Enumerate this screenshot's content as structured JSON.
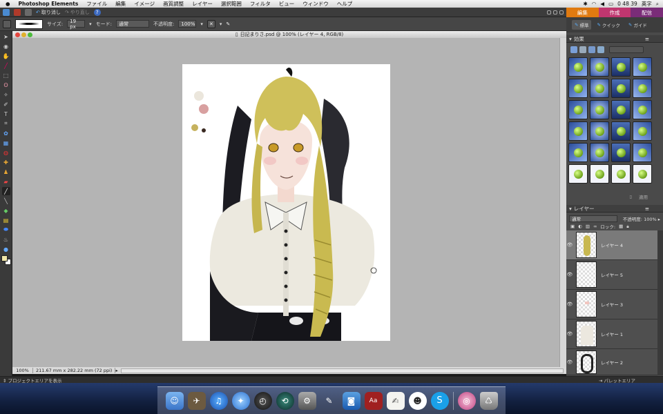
{
  "menubar": {
    "apple": "",
    "items": [
      "Photoshop Elements",
      "ファイル",
      "編集",
      "イメージ",
      "画質調整",
      "レイヤー",
      "選択範囲",
      "フィルタ",
      "ビュー",
      "ウィンドウ",
      "ヘルプ"
    ],
    "clock": "0 48 39",
    "input_method": "英字"
  },
  "appbar": {
    "undo": "取り消し",
    "redo": "やり直し",
    "help": "?"
  },
  "modes": {
    "edit": "編集",
    "create": "作成",
    "share": "配信",
    "colors": {
      "edit": "#e07a10",
      "create": "#c0366f",
      "share": "#7a2c78"
    }
  },
  "options": {
    "size_label": "サイズ:",
    "size_value": "19 px",
    "mode_label": "モード:",
    "mode_value": "通常",
    "opacity_label": "不透明度:",
    "opacity_value": "100%"
  },
  "document": {
    "title": "日記まりさ.psd @ 100% (レイヤー 4, RGB/8)",
    "zoom": "100%",
    "dimensions": "211.67 mm x 282.22 mm (72 ppi)"
  },
  "panel_tabs": {
    "standard": "標準",
    "quick": "クイック",
    "guided": "ガイド"
  },
  "effects": {
    "title": "効果",
    "apply": "適用"
  },
  "layers": {
    "title": "レイヤー",
    "blend_mode": "通常",
    "opacity_label": "不透明度:",
    "opacity_value": "100%",
    "lock_label": "ロック:",
    "items": [
      {
        "name": "レイヤー 4",
        "selected": true
      },
      {
        "name": "レイヤー 5",
        "selected": false
      },
      {
        "name": "レイヤー 3",
        "selected": false
      },
      {
        "name": "レイヤー 1",
        "selected": false
      },
      {
        "name": "レイヤー 2",
        "selected": false
      }
    ]
  },
  "statusbar": {
    "project_bin": "プロジェクトエリアを表示",
    "palette_bin": "パレットエリア"
  },
  "dock": {
    "items": [
      "finder-icon",
      "image-capture-icon",
      "itunes-icon",
      "safari-icon",
      "dashboard-icon",
      "time-machine-icon",
      "system-preferences-icon",
      "brush-icon",
      "iphoto-icon",
      "dictionary-icon",
      "textedit-icon",
      "chat-icon",
      "skype-icon",
      "dvd-player-icon",
      "trash-icon"
    ]
  },
  "swatches": {
    "fg": "#f2e6a8",
    "bg": "#ffffff"
  }
}
